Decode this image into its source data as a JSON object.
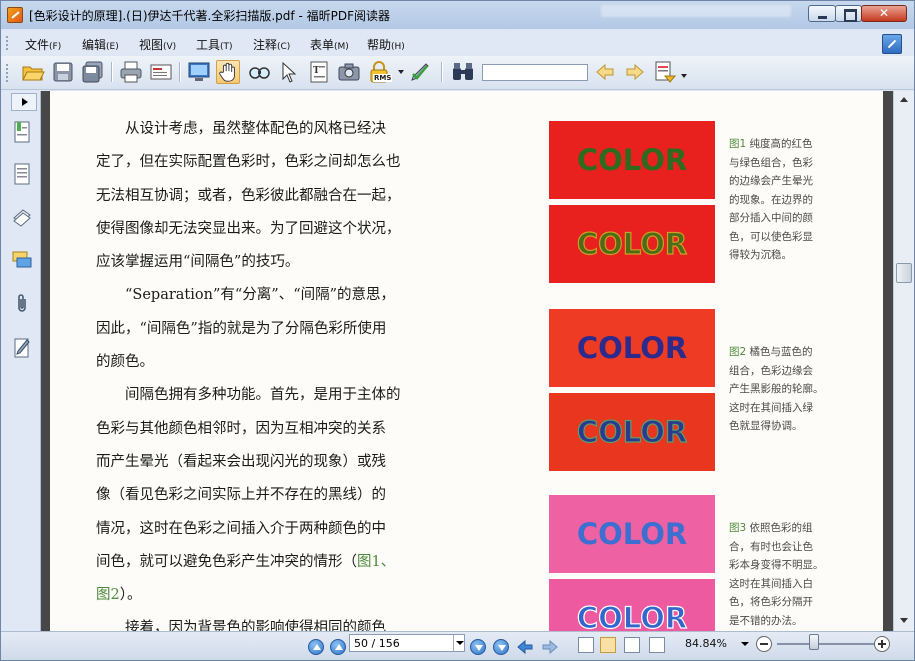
{
  "window": {
    "title": "[色彩设计的原理].(日)伊达千代著.全彩扫描版.pdf - 福昕PDF阅读器"
  },
  "menubar": {
    "items": [
      {
        "label": "文件",
        "key": "(F)"
      },
      {
        "label": "编辑",
        "key": "(E)"
      },
      {
        "label": "视图",
        "key": "(V)"
      },
      {
        "label": "工具",
        "key": "(T)"
      },
      {
        "label": "注释",
        "key": "(C)"
      },
      {
        "label": "表单",
        "key": "(M)"
      },
      {
        "label": "帮助",
        "key": "(H)"
      }
    ]
  },
  "toolbar": {
    "icons": [
      "open-folder-icon",
      "save-icon",
      "save-as-icon",
      "print-icon",
      "email-icon",
      "fullscreen-icon",
      "hand-tool-icon",
      "zoom-tool-icon",
      "select-tool-icon",
      "text-select-icon",
      "snapshot-icon",
      "rms-icon",
      "sign-icon",
      "find-icon",
      "prev-result-icon",
      "next-result-icon",
      "highlight-icon"
    ],
    "rms_label": "RMS",
    "search_value": ""
  },
  "document": {
    "lines": [
      {
        "text": "　　从设计考虑，虽然整体配色的风格已经决",
        "ref": ""
      },
      {
        "text": "定了，但在实际配置色彩时，色彩之间却怎么也",
        "ref": ""
      },
      {
        "text": "无法相互协调；或者，色彩彼此都融合在一起，",
        "ref": ""
      },
      {
        "text": "使得图像却无法突显出来。为了回避这个状况，",
        "ref": ""
      },
      {
        "text": "应该掌握运用“间隔色”的技巧。",
        "ref": ""
      },
      {
        "text": "　　“Separation”有“分离”、“间隔”的意思，",
        "ref": ""
      },
      {
        "text": "因此，“间隔色”指的就是为了分隔色彩所使用",
        "ref": ""
      },
      {
        "text": "的颜色。",
        "ref": ""
      },
      {
        "text": "　　间隔色拥有多种功能。首先，是用于主体的",
        "ref": ""
      },
      {
        "text": "色彩与其他颜色相邻时，因为互相冲突的关系",
        "ref": ""
      },
      {
        "text": "而产生晕光（看起来会出现闪光的现象）或残",
        "ref": ""
      },
      {
        "text": "像（看见色彩之间实际上并不存在的黑线）的",
        "ref": ""
      },
      {
        "text": "情况，这时在色彩之间插入介于两种颜色的中",
        "ref": ""
      },
      {
        "text": "间色，就可以避免色彩产生冲突的情形（",
        "ref": "图1、"
      },
      {
        "text": "",
        "ref": "图2",
        "tail": "）。"
      },
      {
        "text": "　　接着，因为背景色的影响使得相同的颜色",
        "ref": ""
      }
    ],
    "figures": [
      {
        "word": "COLOR",
        "swatches": [
          {
            "bg": "#e8211f",
            "fg": "#2f6a1f",
            "outline": ""
          },
          {
            "bg": "#e8211f",
            "fg": "#4e6b17",
            "outline": "#c9a024"
          }
        ],
        "caption_no": "图1",
        "caption_lines": [
          "纯度高的红色",
          "与绿色组合，色彩",
          "的边缘会产生晕光",
          "的现象。在边界的",
          "部分插入中间的颜",
          "色，可以使色彩显",
          "得较为沉稳。"
        ]
      },
      {
        "word": "COLOR",
        "swatches": [
          {
            "bg": "#ee3b24",
            "fg": "#2c2a8c",
            "outline": ""
          },
          {
            "bg": "#e8361f",
            "fg": "#2b3a8f",
            "outline": "#5aa06a"
          }
        ],
        "caption_no": "图2",
        "caption_lines": [
          "橘色与蓝色的",
          "组合，色彩边缘会",
          "产生黑影般的轮廓。",
          "这时在其间插入绿",
          "色就显得协调。"
        ]
      },
      {
        "word": "COLOR",
        "swatches": [
          {
            "bg": "#ee62a4",
            "fg": "#3c6fd0",
            "outline": ""
          },
          {
            "bg": "#ee5aa0",
            "fg": "#3566cc",
            "outline": "#ffffff"
          }
        ],
        "caption_no": "图3",
        "caption_lines": [
          "依照色彩的组",
          "合，有时也会让色",
          "彩本身变得不明显。",
          "这时在其间插入白",
          "色，将色彩分隔开",
          "是不错的办法。"
        ]
      }
    ]
  },
  "statusbar": {
    "page_display": "50 / 156",
    "zoom": "84.84%"
  },
  "colors": {
    "accent": "#2f72c4",
    "caption_green": "#4e8a3c"
  }
}
